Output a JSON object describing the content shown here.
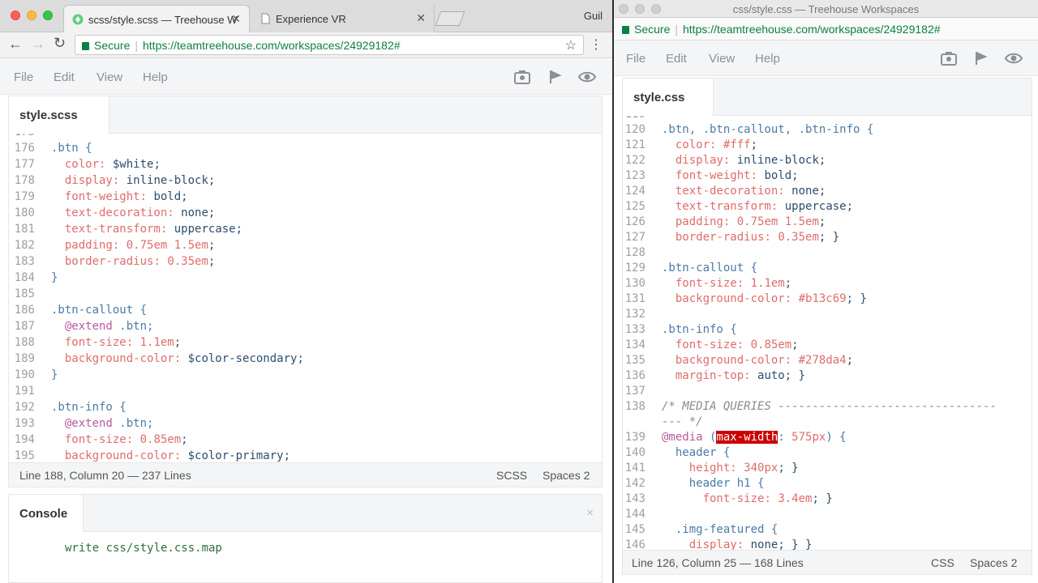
{
  "left_browser": {
    "tabs": [
      {
        "title": "scss/style.scss — Treehouse W"
      },
      {
        "title": "Experience VR"
      }
    ],
    "profile_name": "Guil",
    "address": {
      "secure_label": "Secure",
      "url": "https://teamtreehouse.com/workspaces/24929182#"
    },
    "menu": {
      "file": "File",
      "edit": "Edit",
      "view": "View",
      "help": "Help"
    },
    "file_tab": "style.scss",
    "code_lines": [
      {
        "n": "175",
        "t": ""
      },
      {
        "n": "176",
        "t": ".btn {"
      },
      {
        "n": "177",
        "t": "  color: $white;"
      },
      {
        "n": "178",
        "t": "  display: inline-block;"
      },
      {
        "n": "179",
        "t": "  font-weight: bold;"
      },
      {
        "n": "180",
        "t": "  text-decoration: none;"
      },
      {
        "n": "181",
        "t": "  text-transform: uppercase;"
      },
      {
        "n": "182",
        "t": "  padding: 0.75em 1.5em;"
      },
      {
        "n": "183",
        "t": "  border-radius: 0.35em;"
      },
      {
        "n": "184",
        "t": "}"
      },
      {
        "n": "185",
        "t": ""
      },
      {
        "n": "186",
        "t": ".btn-callout {"
      },
      {
        "n": "187",
        "t": "  @extend .btn;"
      },
      {
        "n": "188",
        "t": "  font-size: 1.1em;"
      },
      {
        "n": "189",
        "t": "  background-color: $color-secondary;"
      },
      {
        "n": "190",
        "t": "}"
      },
      {
        "n": "191",
        "t": ""
      },
      {
        "n": "192",
        "t": ".btn-info {"
      },
      {
        "n": "193",
        "t": "  @extend .btn;"
      },
      {
        "n": "194",
        "t": "  font-size: 0.85em;"
      },
      {
        "n": "195",
        "t": "  background-color: $color-primary;"
      }
    ],
    "status": {
      "position": "Line 188, Column 20 — 237 Lines",
      "mode": "SCSS",
      "indent": "Spaces  2"
    },
    "console": {
      "tab": "Console",
      "close": "×",
      "output": "write css/style.css.map"
    }
  },
  "right_window": {
    "title": "css/style.css — Treehouse Workspaces",
    "address": {
      "secure_label": "Secure",
      "url": "https://teamtreehouse.com/workspaces/24929182#"
    },
    "menu": {
      "file": "File",
      "edit": "Edit",
      "view": "View",
      "help": "Help"
    },
    "file_tab": "style.css",
    "code_lines": [
      {
        "n": "119",
        "t": ""
      },
      {
        "n": "120",
        "t": ".btn, .btn-callout, .btn-info {"
      },
      {
        "n": "121",
        "t": "  color: #fff;"
      },
      {
        "n": "122",
        "t": "  display: inline-block;"
      },
      {
        "n": "123",
        "t": "  font-weight: bold;"
      },
      {
        "n": "124",
        "t": "  text-decoration: none;"
      },
      {
        "n": "125",
        "t": "  text-transform: uppercase;"
      },
      {
        "n": "126",
        "t": "  padding: 0.75em 1.5em;"
      },
      {
        "n": "127",
        "t": "  border-radius: 0.35em; }"
      },
      {
        "n": "128",
        "t": ""
      },
      {
        "n": "129",
        "t": ".btn-callout {"
      },
      {
        "n": "130",
        "t": "  font-size: 1.1em;"
      },
      {
        "n": "131",
        "t": "  background-color: #b13c69; }"
      },
      {
        "n": "132",
        "t": ""
      },
      {
        "n": "133",
        "t": ".btn-info {"
      },
      {
        "n": "134",
        "t": "  font-size: 0.85em;"
      },
      {
        "n": "135",
        "t": "  background-color: #278da4;"
      },
      {
        "n": "136",
        "t": "  margin-top: auto; }"
      },
      {
        "n": "137",
        "t": ""
      },
      {
        "n": "138",
        "t": "/* MEDIA QUERIES --------------------------------"
      },
      {
        "n": "",
        "t": "--- */"
      },
      {
        "n": "139",
        "t": "@media (max-width: 575px) {"
      },
      {
        "n": "140",
        "t": "  header {"
      },
      {
        "n": "141",
        "t": "    height: 340px; }"
      },
      {
        "n": "142",
        "t": "    header h1 {"
      },
      {
        "n": "143",
        "t": "      font-size: 3.4em; }"
      },
      {
        "n": "144",
        "t": ""
      },
      {
        "n": "145",
        "t": "  .img-featured {"
      },
      {
        "n": "146",
        "t": "    display: none; } }"
      }
    ],
    "status": {
      "position": "Line 126, Column 25 — 168 Lines",
      "mode": "CSS",
      "indent": "Spaces  2"
    }
  },
  "icons": [
    "camera-icon",
    "share-icon",
    "eye-icon",
    "star-icon",
    "menu-icon",
    "close-icon"
  ]
}
